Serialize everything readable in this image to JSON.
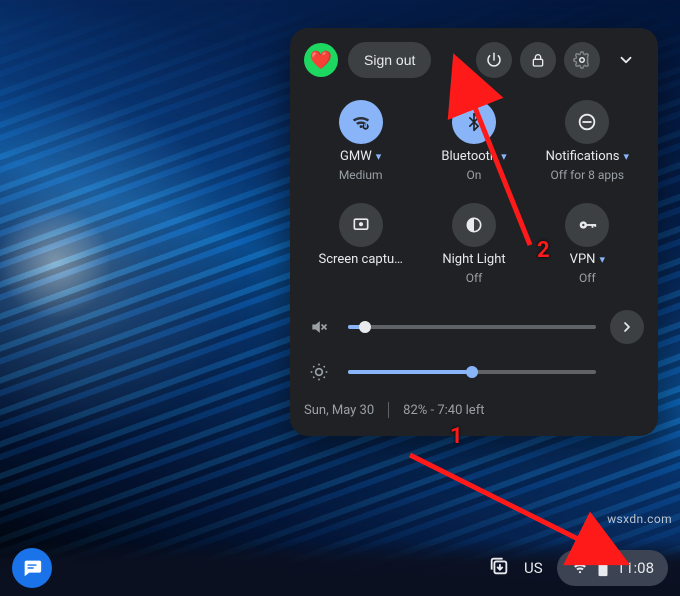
{
  "panel": {
    "sign_out_label": "Sign out",
    "avatar_emoji": "❤️",
    "tiles": {
      "wifi": {
        "label": "GMW",
        "sub": "Medium",
        "has_caret": true,
        "on": true
      },
      "bluetooth": {
        "label": "Bluetooth",
        "sub": "On",
        "has_caret": true,
        "on": true
      },
      "notifications": {
        "label": "Notifications",
        "sub": "Off for 8 apps",
        "has_caret": true,
        "on": false
      },
      "screencap": {
        "label": "Screen captu…",
        "sub": "",
        "has_caret": false,
        "on": false
      },
      "nightlight": {
        "label": "Night Light",
        "sub": "Off",
        "has_caret": false,
        "on": false
      },
      "vpn": {
        "label": "VPN",
        "sub": "Off",
        "has_caret": true,
        "on": false
      }
    },
    "footer": {
      "date": "Sun, May 30",
      "battery": "82% - 7:40 left"
    }
  },
  "taskbar": {
    "keyboard_indicator": "US",
    "clock": "11:08"
  },
  "annotations": {
    "marker1": "1",
    "marker2": "2"
  },
  "watermark": "wsxdn.com"
}
